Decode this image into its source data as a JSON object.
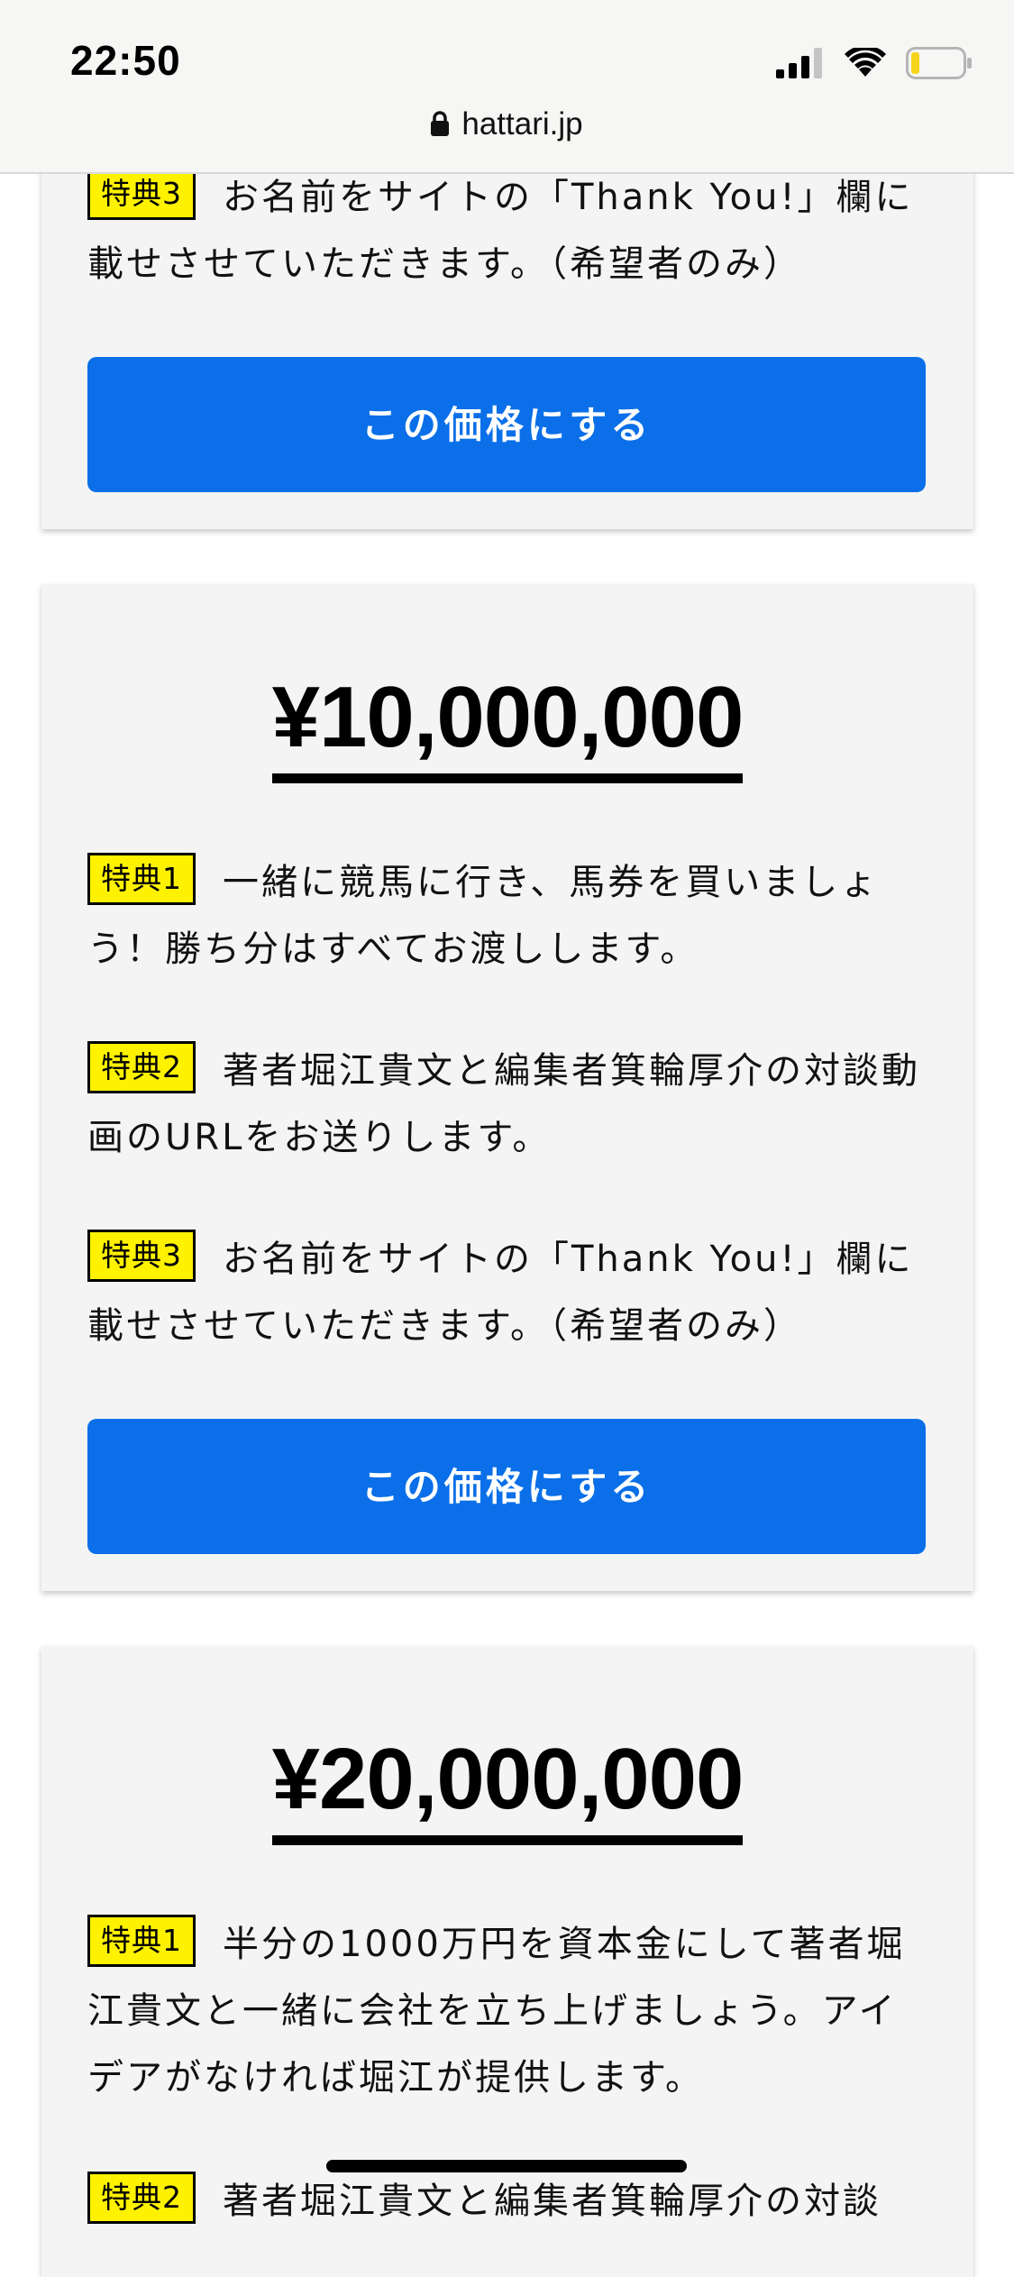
{
  "status_bar": {
    "time": "22:50",
    "icons": [
      "signal-icon",
      "wifi-icon",
      "battery-icon"
    ]
  },
  "browser": {
    "url": "hattari.jp",
    "icon": "lock-icon"
  },
  "colors": {
    "badge_bg": "#fff200",
    "button_bg": "#0a6fe8",
    "card_bg": "#f4f4f4",
    "battery_fill": "#f7d51d"
  },
  "cards": [
    {
      "benefits": [
        {
          "badge": "特典3",
          "text": "お名前をサイトの「Thank You!」欄に載せさせていただきます。（希望者のみ）"
        }
      ],
      "button_label": "この価格にする"
    },
    {
      "price": "¥10,000,000",
      "benefits": [
        {
          "badge": "特典1",
          "text": "一緒に競馬に行き、馬券を買いましょう！勝ち分はすべてお渡しします。"
        },
        {
          "badge": "特典2",
          "text": "著者堀江貴文と編集者箕輪厚介の対談動画のURLをお送りします。"
        },
        {
          "badge": "特典3",
          "text": "お名前をサイトの「Thank You!」欄に載せさせていただきます。（希望者のみ）"
        }
      ],
      "button_label": "この価格にする"
    },
    {
      "price": "¥20,000,000",
      "benefits": [
        {
          "badge": "特典1",
          "text": "半分の1000万円を資本金にして著者堀江貴文と一緒に会社を立ち上げましょう。アイデアがなければ堀江が提供します。"
        },
        {
          "badge": "特典2",
          "text": "著者堀江貴文と編集者箕輪厚介の対談"
        }
      ]
    }
  ]
}
